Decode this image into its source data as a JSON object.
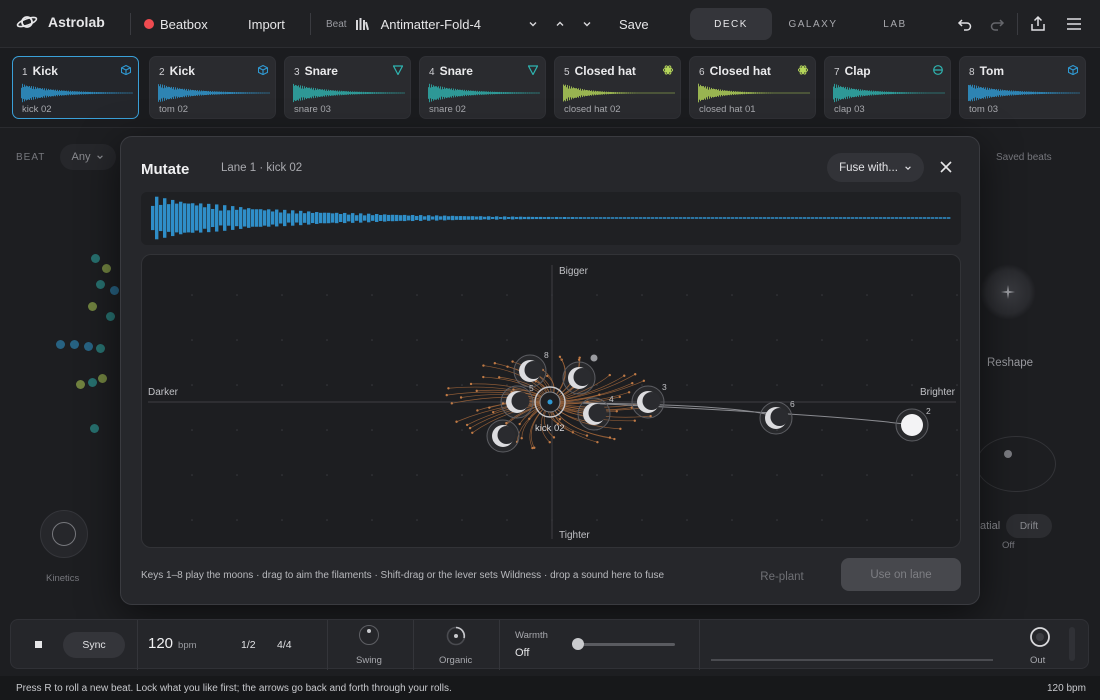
{
  "app": {
    "name": "Astrolab"
  },
  "topbar": {
    "beatbox_label": "Beatbox",
    "import_label": "Import",
    "beat_label": "Beat",
    "beat_name": "Antimatter-Fold-4",
    "save_label": "Save",
    "tabs": [
      {
        "label": "DECK",
        "active": true
      },
      {
        "label": "GALAXY",
        "active": false
      },
      {
        "label": "LAB",
        "active": false
      }
    ]
  },
  "lanes": [
    {
      "num": "1",
      "name": "Kick",
      "sample": "kick 02",
      "color": "#2f9ad4",
      "icon": "cube-icon",
      "selected": true
    },
    {
      "num": "2",
      "name": "Kick",
      "sample": "tom 02",
      "color": "#2f9ad4",
      "icon": "cube-icon",
      "selected": false
    },
    {
      "num": "3",
      "name": "Snare",
      "sample": "snare 03",
      "color": "#2fb4b0",
      "icon": "triangle-icon",
      "selected": false
    },
    {
      "num": "4",
      "name": "Snare",
      "sample": "snare 02",
      "color": "#2fb4b0",
      "icon": "triangle-icon",
      "selected": false
    },
    {
      "num": "5",
      "name": "Closed hat",
      "sample": "closed hat 02",
      "color": "#b5d65a",
      "icon": "atom-icon",
      "selected": false
    },
    {
      "num": "6",
      "name": "Closed hat",
      "sample": "closed hat 01",
      "color": "#b5d65a",
      "icon": "atom-icon",
      "selected": false
    },
    {
      "num": "7",
      "name": "Clap",
      "sample": "clap 03",
      "color": "#2fb4b0",
      "icon": "orb-icon",
      "selected": false
    },
    {
      "num": "8",
      "name": "Tom",
      "sample": "tom 03",
      "color": "#2f9ad4",
      "icon": "cube-icon",
      "selected": false
    }
  ],
  "background": {
    "beat_label": "BEAT",
    "any_label": "Any",
    "saved_beats": "Saved beats",
    "reshape": "Reshape",
    "kinetics": "Kinetics",
    "spatial": "atial",
    "drift": "Drift",
    "off": "Off"
  },
  "mutate": {
    "title": "Mutate",
    "subtitle": "Lane 1 · kick 02",
    "fuse_label": "Fuse with...",
    "axes": {
      "top": "Bigger",
      "bottom": "Tighter",
      "left": "Darker",
      "right": "Brighter"
    },
    "center_label": "kick 02",
    "moon_labels": [
      "8",
      "5",
      "4",
      "3",
      "6",
      "2"
    ],
    "hint": "Keys 1–8 play the moons · drag to aim the filaments · Shift-drag or the lever sets Wildness · drop a sound here to fuse",
    "replant_label": "Re-plant",
    "use_label": "Use on lane"
  },
  "transport": {
    "sync_label": "Sync",
    "bpm_value": "120",
    "bpm_unit": "bpm",
    "division": "1/2",
    "meter": "4/4",
    "swing_label": "Swing",
    "organic_label": "Organic",
    "warmth_label": "Warmth",
    "warmth_value": "Off",
    "out_label": "Out"
  },
  "status": {
    "message": "Press R to roll a new beat. Lock what you like first; the arrows go back and forth through your rolls.",
    "bpm": "120 bpm"
  }
}
